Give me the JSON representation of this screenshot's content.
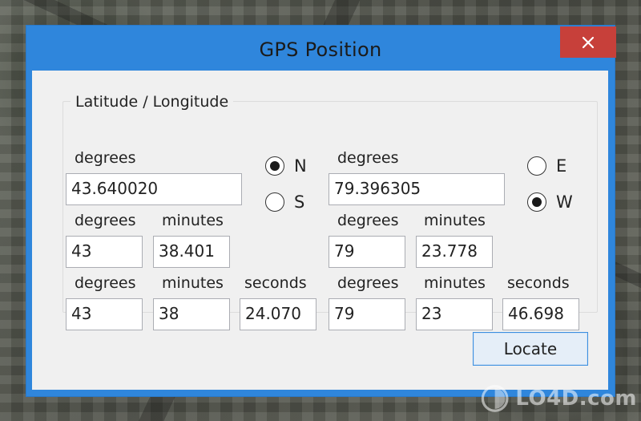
{
  "window": {
    "title": "GPS Position",
    "accent": "#2f86dc",
    "close_color": "#c7403a"
  },
  "group": {
    "label": "Latitude / Longitude"
  },
  "latitude": {
    "decimal_label": "degrees",
    "decimal_value": "43.640020",
    "dm": {
      "degrees_label": "degrees",
      "degrees_value": "43",
      "minutes_label": "minutes",
      "minutes_value": "38.401"
    },
    "dms": {
      "degrees_label": "degrees",
      "degrees_value": "43",
      "minutes_label": "minutes",
      "minutes_value": "38",
      "seconds_label": "seconds",
      "seconds_value": "24.070"
    },
    "hemisphere": {
      "options": [
        "N",
        "S"
      ],
      "selected": "N"
    }
  },
  "longitude": {
    "decimal_label": "degrees",
    "decimal_value": "79.396305",
    "dm": {
      "degrees_label": "degrees",
      "degrees_value": "79",
      "minutes_label": "minutes",
      "minutes_value": "23.778"
    },
    "dms": {
      "degrees_label": "degrees",
      "degrees_value": "79",
      "minutes_label": "minutes",
      "minutes_value": "23",
      "seconds_label": "seconds",
      "seconds_value": "46.698"
    },
    "hemisphere": {
      "options": [
        "E",
        "W"
      ],
      "selected": "W"
    }
  },
  "buttons": {
    "locate_label": "Locate"
  },
  "watermark": {
    "text": "LO4D.com",
    "icon": "lo4d-logo-icon"
  }
}
